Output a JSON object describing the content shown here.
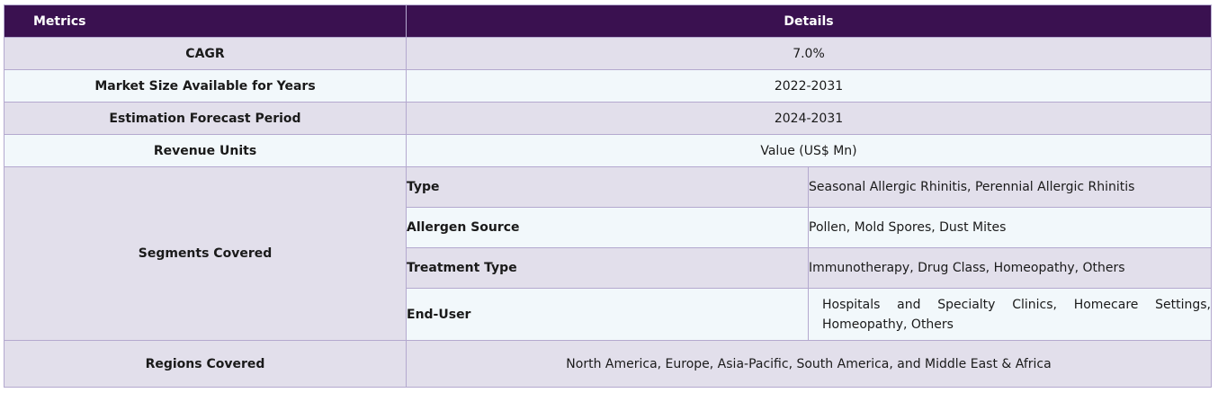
{
  "header": {
    "metrics": "Metrics",
    "details": "Details"
  },
  "rows": [
    {
      "metric": "CAGR",
      "value": "7.0%"
    },
    {
      "metric": "Market Size Available for Years",
      "value": "2022-2031"
    },
    {
      "metric": "Estimation Forecast Period",
      "value": "2024-2031"
    },
    {
      "metric": "Revenue Units",
      "value": "Value (US$ Mn)"
    }
  ],
  "segments": {
    "label": "Segments Covered",
    "items": [
      {
        "key": "Type",
        "value": "Seasonal Allergic Rhinitis, Perennial Allergic Rhinitis"
      },
      {
        "key": "Allergen Source",
        "value": "Pollen, Mold Spores, Dust Mites"
      },
      {
        "key": "Treatment Type",
        "value": "Immunotherapy, Drug Class, Homeopathy, Others"
      },
      {
        "key": "End-User",
        "value": "Hospitals and Specialty Clinics, Homecare Settings, Homeopathy, Others"
      }
    ]
  },
  "regions": {
    "label": "Regions Covered",
    "value": "North America, Europe, Asia-Pacific, South America, and Middle East & Africa"
  },
  "colors": {
    "header_bg": "#3a1150",
    "row_alt": "#e2dfeb",
    "row_light": "#f2f8fb",
    "border": "#b4a9cf"
  }
}
